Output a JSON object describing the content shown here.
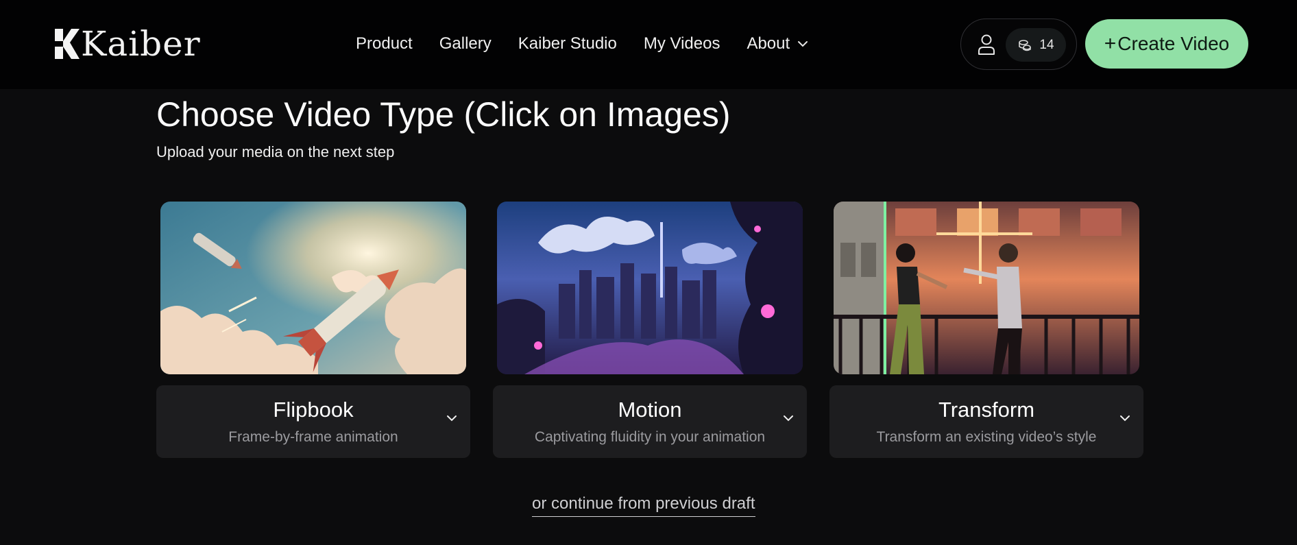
{
  "header": {
    "brand": "Kaiber",
    "nav": [
      {
        "label": "Product"
      },
      {
        "label": "Gallery"
      },
      {
        "label": "Kaiber Studio"
      },
      {
        "label": "My Videos"
      },
      {
        "label": "About"
      }
    ],
    "credits": "14",
    "create_label": "Create Video",
    "create_plus": "+",
    "accent_color": "#91e0a6"
  },
  "main": {
    "title": "Choose Video Type (Click on Images)",
    "subtitle": "Upload your media on the next step",
    "cards": [
      {
        "title": "Flipbook",
        "description": "Frame-by-frame animation"
      },
      {
        "title": "Motion",
        "description": "Captivating fluidity in your animation"
      },
      {
        "title": "Transform",
        "description": "Transform an existing video’s style"
      }
    ],
    "draft_link": "or continue from previous draft"
  },
  "icons": {
    "logo": "kaiber-logo-icon",
    "user": "user-icon",
    "credits": "coins-icon",
    "chevron": "chevron-down-icon"
  }
}
